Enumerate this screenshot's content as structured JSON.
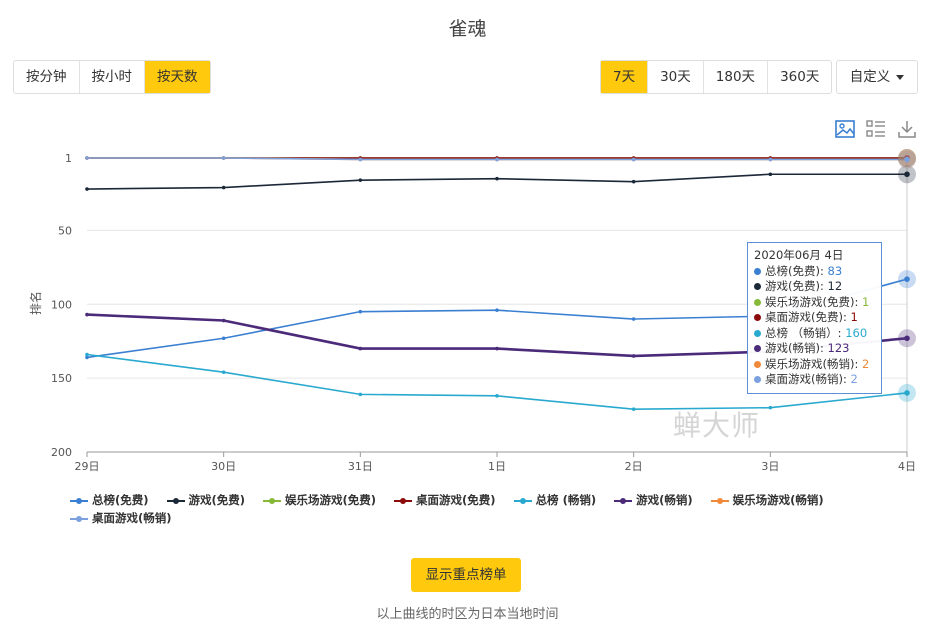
{
  "title": "雀魂",
  "granularity": {
    "options": [
      "按分钟",
      "按小时",
      "按天数"
    ],
    "active": 2
  },
  "range": {
    "options": [
      "7天",
      "30天",
      "180天",
      "360天"
    ],
    "active": 0
  },
  "custom_label": "自定义",
  "toolbox": [
    "image-icon",
    "data-view-icon",
    "download-icon"
  ],
  "watermark": "蝉大师",
  "show_key_button": "显示重点榜单",
  "footnote": "以上曲线的时区为日本当地时间",
  "tooltip": {
    "date": "2020年06月 4日",
    "rows": [
      {
        "label": "总榜(免费): ",
        "value": "83",
        "color": "#3a7fd1"
      },
      {
        "label": "游戏(免费): ",
        "value": "12",
        "color": "#1b2838"
      },
      {
        "label": "娱乐场游戏(免费): ",
        "value": "1",
        "color": "#86b938"
      },
      {
        "label": "桌面游戏(免费): ",
        "value": "1",
        "color": "#8b0a0a"
      },
      {
        "label": "总榜 （畅销）: ",
        "value": "160",
        "color": "#29a9cf"
      },
      {
        "label": "游戏(畅销): ",
        "value": "123",
        "color": "#4b2a7a"
      },
      {
        "label": "娱乐场游戏(畅销): ",
        "value": "2",
        "color": "#f08a3a"
      },
      {
        "label": "桌面游戏(畅销): ",
        "value": "2",
        "color": "#7aa0e0"
      }
    ]
  },
  "chart_data": {
    "type": "line",
    "categories": [
      "29日",
      "30日",
      "31日",
      "1日",
      "2日",
      "3日",
      "4日"
    ],
    "ylabel": "排名",
    "ylim": [
      1,
      200
    ],
    "yticks": [
      1,
      50,
      100,
      150,
      200
    ],
    "y_inverted": true,
    "grid": true,
    "legend_position": "bottom",
    "series": [
      {
        "name": "总榜(免费)",
        "color": "#3a7fd1",
        "values": [
          136,
          123,
          105,
          104,
          110,
          108,
          83
        ]
      },
      {
        "name": "游戏(免费)",
        "color": "#1b2838",
        "values": [
          22,
          21,
          16,
          15,
          17,
          12,
          12
        ]
      },
      {
        "name": "娱乐场游戏(免费)",
        "color": "#86b938",
        "values": [
          1,
          1,
          1,
          1,
          1,
          1,
          1
        ]
      },
      {
        "name": "桌面游戏(免费)",
        "color": "#8b0a0a",
        "values": [
          1,
          1,
          1,
          1,
          1,
          1,
          1
        ]
      },
      {
        "name": "总榜  (畅销)",
        "color": "#29a9cf",
        "values": [
          134,
          146,
          161,
          162,
          171,
          170,
          160
        ]
      },
      {
        "name": "游戏(畅销)",
        "color": "#4b2a7a",
        "values": [
          107,
          111,
          130,
          130,
          135,
          132,
          123
        ]
      },
      {
        "name": "娱乐场游戏(畅销)",
        "color": "#f08a3a",
        "values": [
          1,
          1,
          2,
          2,
          2,
          2,
          2
        ]
      },
      {
        "name": "桌面游戏(畅销)",
        "color": "#7aa0e0",
        "values": [
          1,
          1,
          2,
          2,
          2,
          2,
          2
        ]
      }
    ]
  }
}
